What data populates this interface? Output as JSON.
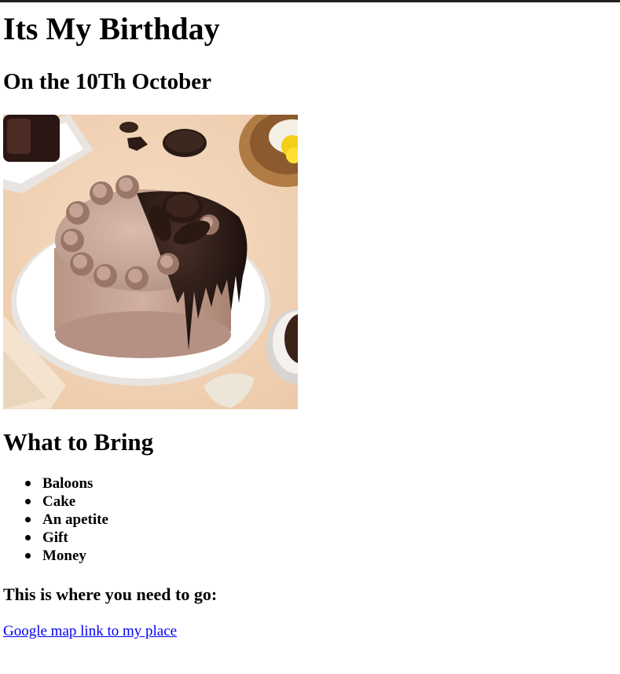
{
  "page": {
    "title": "Its My Birthday",
    "subtitle": "On the 10Th October"
  },
  "image": {
    "icon": "birthday-cake-photo",
    "description_alt": ""
  },
  "bring": {
    "heading": "What to Bring",
    "items": [
      {
        "label": "Baloons"
      },
      {
        "label": "Cake"
      },
      {
        "label": "An apetite"
      },
      {
        "label": "Gift"
      },
      {
        "label": "Money"
      }
    ]
  },
  "directions": {
    "heading": "This is where you need to go:",
    "link_label": "Google map link to my place"
  },
  "colors": {
    "link": "#0000ee",
    "top_border": "#202020"
  }
}
